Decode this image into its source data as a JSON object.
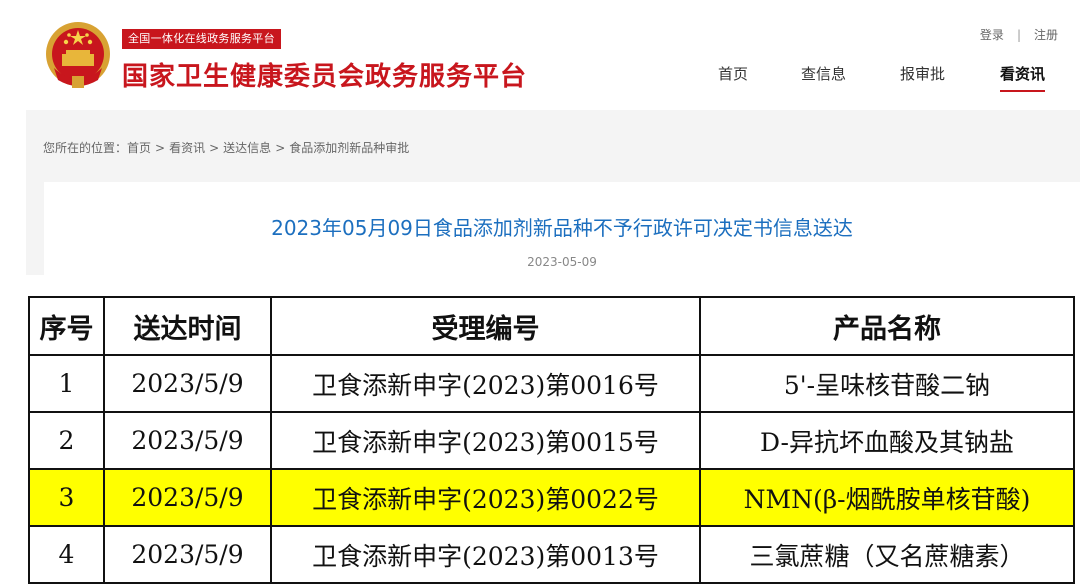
{
  "header": {
    "platform_tag": "全国一体化在线政务服务平台",
    "site_title": "国家卫生健康委员会政务服务平台",
    "user_links": {
      "login": "登录",
      "separator": "|",
      "register": "注册"
    },
    "nav": [
      {
        "label": "首页",
        "active": false
      },
      {
        "label": "查信息",
        "active": false
      },
      {
        "label": "报审批",
        "active": false
      },
      {
        "label": "看资讯",
        "active": true
      }
    ]
  },
  "breadcrumb": {
    "prefix": "您所在的位置：",
    "items": [
      "首页",
      "看资讯",
      "送达信息",
      "食品添加剂新品种审批"
    ],
    "separator": ">"
  },
  "article": {
    "title": "2023年05月09日食品添加剂新品种不予行政许可决定书信息送达",
    "date": "2023-05-09"
  },
  "table": {
    "headers": [
      "序号",
      "送达时间",
      "受理编号",
      "产品名称"
    ],
    "rows": [
      {
        "no": "1",
        "date": "2023/5/9",
        "code": "卫食添新申字(2023)第0016号",
        "product": "5'-呈味核苷酸二钠",
        "highlighted": false
      },
      {
        "no": "2",
        "date": "2023/5/9",
        "code": "卫食添新申字(2023)第0015号",
        "product": "D-异抗坏血酸及其钠盐",
        "highlighted": false
      },
      {
        "no": "3",
        "date": "2023/5/9",
        "code": "卫食添新申字(2023)第0022号",
        "product": "NMN(β-烟酰胺单核苷酸)",
        "highlighted": true
      },
      {
        "no": "4",
        "date": "2023/5/9",
        "code": "卫食添新申字(2023)第0013号",
        "product": "三氯蔗糖（又名蔗糖素）",
        "highlighted": false
      }
    ]
  },
  "colors": {
    "brand_red": "#c8161d",
    "title_blue": "#1c6fbf",
    "highlight_yellow": "#ffff00",
    "band_gray": "#f4f4f4"
  },
  "icons": {
    "emblem": "national-emblem-icon"
  }
}
